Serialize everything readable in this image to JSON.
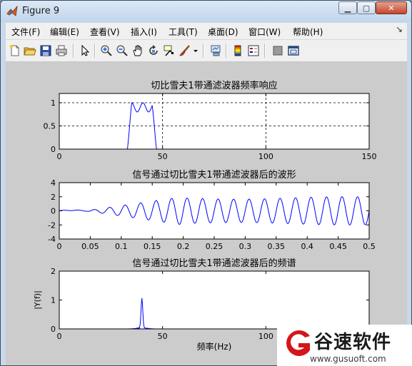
{
  "window": {
    "title": "Figure 9"
  },
  "menu": [
    "文件(F)",
    "编辑(E)",
    "查看(V)",
    "插入(I)",
    "工具(T)",
    "桌面(D)",
    "窗口(W)",
    "帮助(H)"
  ],
  "menu_dock_glyph": "↘",
  "toolbar": [
    "new-figure-icon",
    "open-icon",
    "save-icon",
    "print-icon",
    "pointer-icon",
    "zoom-in-icon",
    "zoom-out-icon",
    "pan-icon",
    "rotate-3d-icon",
    "data-cursor-icon",
    "brush-icon",
    "link-icon",
    "colorbar-icon",
    "legend-icon",
    "hide-plot-tools-icon",
    "show-plot-tools-icon"
  ],
  "watermark": {
    "brand": "谷速软件",
    "url": "www.gusuoft.com"
  },
  "chart_data": [
    {
      "type": "line",
      "title": "切比雪夫1带通滤波器频率响应",
      "xlabel": "",
      "ylabel": "",
      "xlim": [
        0,
        150
      ],
      "ylim": [
        0,
        1.2
      ],
      "xticks": [
        0,
        50,
        100,
        150
      ],
      "yticks": [
        0,
        0.5,
        1
      ],
      "grid": true,
      "series": [
        {
          "color": "#0000ff",
          "description": "passband approx. 35-46 with equiripple between 0.8 and 1"
        }
      ]
    },
    {
      "type": "line",
      "title": "信号通过切比雪夫1带通滤波器后的波形",
      "xlabel": "",
      "ylabel": "",
      "xlim": [
        0,
        0.5
      ],
      "ylim": [
        -4,
        4
      ],
      "xticks": [
        0,
        0.05,
        0.1,
        0.15,
        0.2,
        0.25,
        0.3,
        0.35,
        0.4,
        0.45,
        0.5
      ],
      "yticks": [
        -4,
        -2,
        0,
        2,
        4
      ],
      "grid": false,
      "series": [
        {
          "color": "#0000ff",
          "description": "oscillation ~40 Hz, amplitude growing to ~2 after t≈0.15"
        }
      ]
    },
    {
      "type": "line",
      "title": "信号通过切比雪夫1带通滤波器后的频谱",
      "xlabel": "频率(Hz)",
      "ylabel": "|Y(f)|",
      "xlim": [
        0,
        150
      ],
      "ylim": [
        0,
        2
      ],
      "xticks": [
        0,
        50,
        100
      ],
      "yticks": [
        0,
        1,
        2
      ],
      "grid": false,
      "series": [
        {
          "color": "#0000ff",
          "description": "single peak near 40 Hz, height ~1"
        }
      ]
    }
  ]
}
